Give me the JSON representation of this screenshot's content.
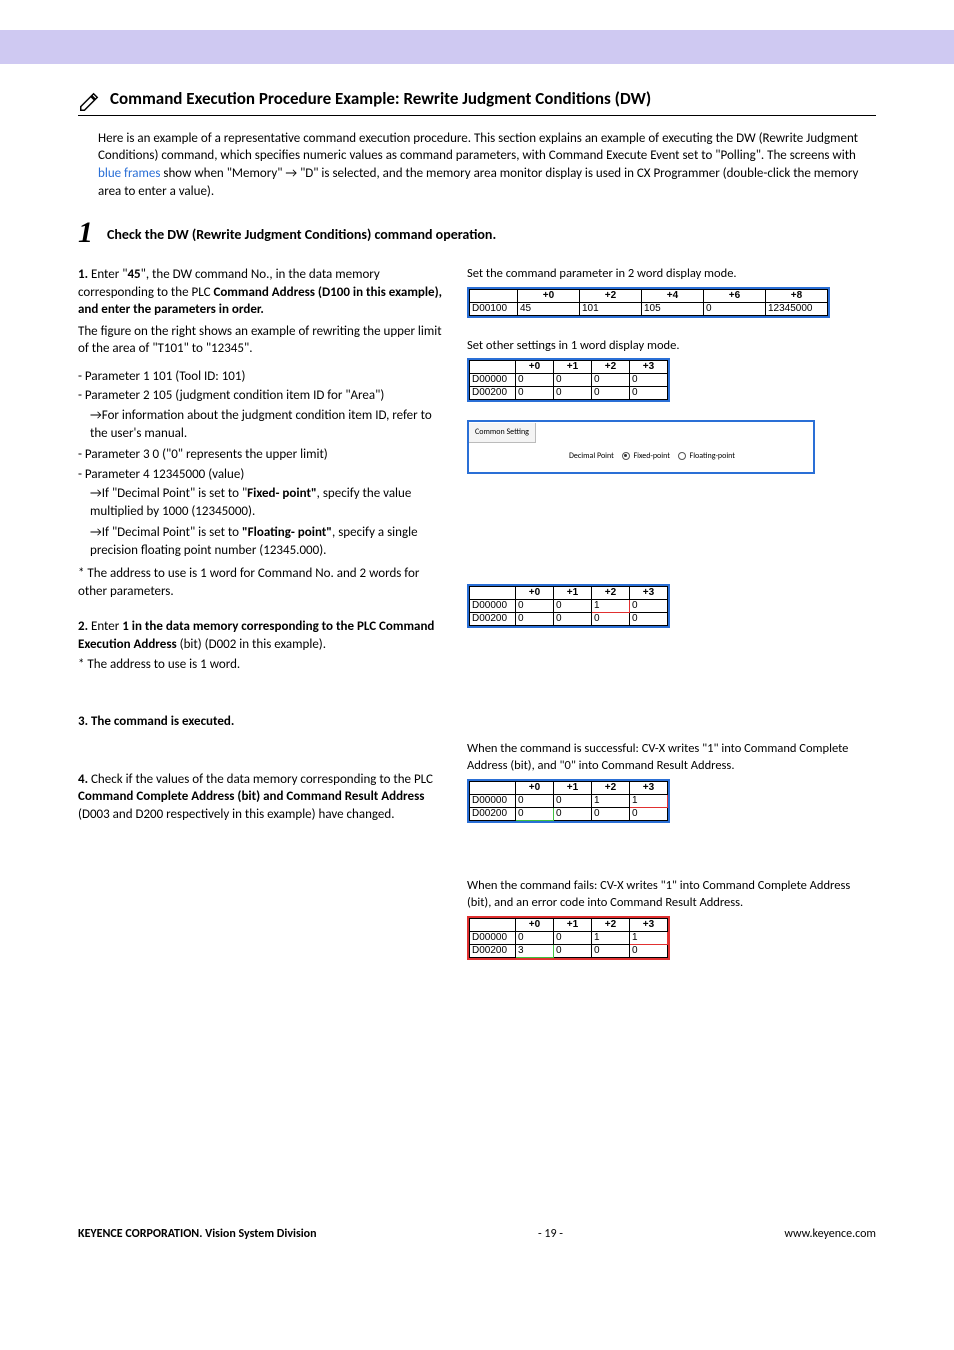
{
  "heading": "Command Execution Procedure Example: Rewrite Judgment Conditions (DW)",
  "intro_parts": {
    "a": "Here is an example of a representative command execution procedure. This section explains an example of executing the DW (Rewrite Judgment Conditions) command, which specifies numeric values as command parameters, with Command Execute Event set to \"Polling\". The screens with ",
    "link": "blue frames",
    "b": " show when \"Memory\" → \"D\" is selected, and the memory area monitor display is used in CX Programmer (double-click the memory area to enter a value)."
  },
  "step": {
    "num": "1",
    "title": "Check the DW (Rewrite Judgment Conditions) command operation."
  },
  "left": {
    "s1_lead_num": "1.",
    "s1_lead_a": " Enter \"",
    "s1_lead_bold1": "45",
    "s1_lead_b": "\", the DW command No., in the data memory corresponding to the PLC ",
    "s1_lead_bold2": "Command Address (D100 in this example), and enter the parameters in order.",
    "s1_body": "The figure on the right shows an example of rewriting the upper limit of the area of \"T101\" to \"12345\".",
    "p1": "- Parameter 1  101  (Tool ID: 101)",
    "p2": "- Parameter 2  105  (judgment condition item ID for \"Area\")",
    "p2a": "→For information about the judgment condition item ID, refer to the user's manual.",
    "p3": "- Parameter 3  0  (\"0\" represents the upper limit)",
    "p4": "- Parameter 4  12345000  (value)",
    "p4a": "→If \"Decimal Point\" is set to \"",
    "p4a_bold": "Fixed- point\"",
    "p4a_end": ", specify the value multiplied by 1000 (12345000).",
    "p4b": "→If \"Decimal Point\" is set to ",
    "p4b_bold": "\"Floating- point\"",
    "p4b_end": ", specify a single precision floating point number (12345.000).",
    "s1_note": "* The address to use is 1 word for Command No. and 2 words for other parameters.",
    "s2_num": "2.",
    "s2_a": " Enter ",
    "s2_bold": "1 in the data memory corresponding to the PLC Command Execution Address",
    "s2_b": " (bit) (D002 in this example).",
    "s2_note": "* The address to use is 1 word.",
    "s3": "3. The command is executed.",
    "s4_num": "4.",
    "s4_a": " Check if the values of the data memory corresponding to the PLC ",
    "s4_bold": "Command Complete Address (bit) and Command Result Address",
    "s4_b": " (D003 and D200 respectively in this example) have changed."
  },
  "right": {
    "cap1": "Set the command parameter in 2 word display mode.",
    "cap2": "Set other settings in 1 word display mode.",
    "cs_tab": "Common Setting",
    "cs_label": "Decimal Point",
    "cs_opt1": "Fixed-point",
    "cs_opt2": "Floating-point",
    "table_wide": {
      "headers": [
        "",
        "+0",
        "+2",
        "+4",
        "+6",
        "+8"
      ],
      "rows": [
        [
          "D00100",
          "45",
          "101",
          "105",
          "0",
          "12345000"
        ]
      ]
    },
    "table_small_a": {
      "headers": [
        "",
        "+0",
        "+1",
        "+2",
        "+3"
      ],
      "rows": [
        [
          "D00000",
          "0",
          "0",
          "0",
          "0"
        ],
        [
          "D00200",
          "0",
          "0",
          "0",
          "0"
        ]
      ]
    },
    "table_step2": {
      "headers": [
        "",
        "+0",
        "+1",
        "+2",
        "+3"
      ],
      "rows": [
        [
          "D00000",
          "0",
          "0",
          "1",
          "0"
        ],
        [
          "D00200",
          "0",
          "0",
          "0",
          "0"
        ]
      ],
      "hl": {
        "row": 0,
        "col": 3,
        "cls": "hl-red"
      }
    },
    "cap_success": "When the command is successful: CV-X writes \"1\" into Command Complete Address (bit), and \"0\" into Command Result Address.",
    "table_success": {
      "headers": [
        "",
        "+0",
        "+1",
        "+2",
        "+3"
      ],
      "rows": [
        [
          "D00000",
          "0",
          "0",
          "1",
          "1"
        ],
        [
          "D00200",
          "0",
          "0",
          "0",
          "0"
        ]
      ],
      "hls": [
        {
          "row": 0,
          "col": 4,
          "cls": "hl-red"
        },
        {
          "row": 1,
          "col": 1,
          "cls": "hl-grn"
        }
      ]
    },
    "cap_fail": "When the command fails: CV-X writes \"1\" into Command Complete Address (bit), and an error code into Command Result Address.",
    "table_fail": {
      "headers": [
        "",
        "+0",
        "+1",
        "+2",
        "+3"
      ],
      "rows": [
        [
          "D00000",
          "0",
          "0",
          "1",
          "1"
        ],
        [
          "D00200",
          "3",
          "0",
          "0",
          "0"
        ]
      ],
      "hls": [
        {
          "row": 0,
          "col": 4,
          "cls": "hl-red"
        },
        {
          "row": 1,
          "col": 1,
          "cls": "hl-grn"
        }
      ]
    }
  },
  "footer": {
    "left": "KEYENCE CORPORATION. Vision System Division",
    "center": "- 19 -",
    "right": "www.keyence.com"
  }
}
